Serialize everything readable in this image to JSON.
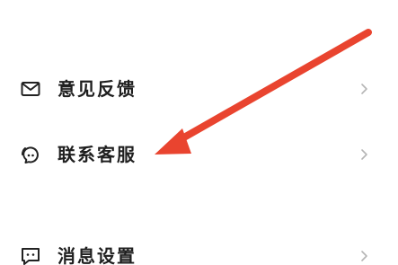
{
  "menu": {
    "items": [
      {
        "label": "意见反馈",
        "icon": "mail-icon"
      },
      {
        "label": "联系客服",
        "icon": "chat-support-icon"
      },
      {
        "label": "消息设置",
        "icon": "message-icon"
      }
    ]
  },
  "colors": {
    "text": "#1f1f1f",
    "icon": "#222222",
    "chevron": "#b5b5b5",
    "annotation_arrow": "#e9442f",
    "background": "#ffffff"
  }
}
